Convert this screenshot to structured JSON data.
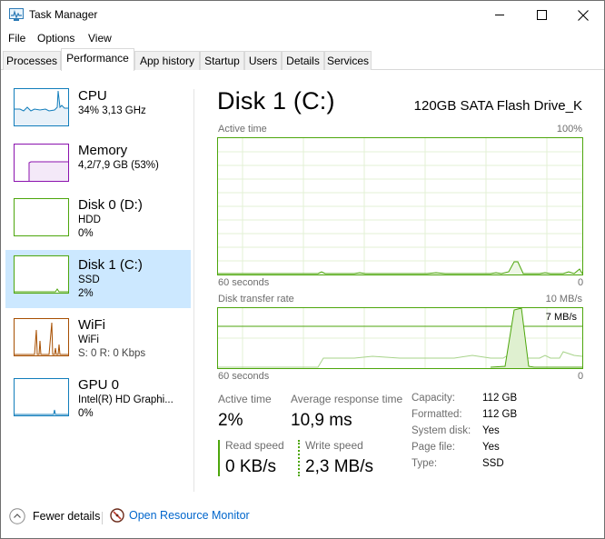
{
  "window": {
    "title": "Task Manager",
    "buttons": [
      "minimize",
      "maximize",
      "close"
    ]
  },
  "menu": {
    "items": [
      "File",
      "Options",
      "View"
    ]
  },
  "tabs": [
    {
      "label": "Processes",
      "active": false
    },
    {
      "label": "Performance",
      "active": true
    },
    {
      "label": "App history",
      "active": false
    },
    {
      "label": "Startup",
      "active": false
    },
    {
      "label": "Users",
      "active": false
    },
    {
      "label": "Details",
      "active": false
    },
    {
      "label": "Services",
      "active": false
    }
  ],
  "sidebar": {
    "items": [
      {
        "name": "CPU",
        "line1": "34% 3,13 GHz",
        "line2": "",
        "color": "#117dbb"
      },
      {
        "name": "Memory",
        "line1": "4,2/7,9 GB (53%)",
        "line2": "",
        "color": "#8b12ae"
      },
      {
        "name": "Disk 0 (D:)",
        "line1": "HDD",
        "line2": "0%",
        "color": "#4da60c"
      },
      {
        "name": "Disk 1 (C:)",
        "line1": "SSD",
        "line2": "2%",
        "color": "#4da60c",
        "selected": true
      },
      {
        "name": "WiFi",
        "line1": "WiFi",
        "line2": "S: 0 R: 0 Kbps",
        "color": "#a74f01"
      },
      {
        "name": "GPU 0",
        "line1": "Intel(R) HD Graphi...",
        "line2": "0%",
        "color": "#117dbb"
      }
    ]
  },
  "main": {
    "title": "Disk 1 (C:)",
    "model": "120GB SATA Flash Drive_K",
    "active_time_graph": {
      "label": "Active time",
      "max_label": "100%",
      "time_label": "60 seconds",
      "min_label": "0"
    },
    "transfer_graph": {
      "label": "Disk transfer rate",
      "max_label": "10 MB/s",
      "line_label": "7 MB/s",
      "time_label": "60 seconds",
      "min_label": "0"
    },
    "stats": {
      "active_time_label": "Active time",
      "active_time_value": "2%",
      "avg_response_label": "Average response time",
      "avg_response_value": "10,9 ms",
      "read_speed_label": "Read speed",
      "read_speed_value": "0 KB/s",
      "write_speed_label": "Write speed",
      "write_speed_value": "2,3 MB/s"
    },
    "properties": [
      {
        "label": "Capacity:",
        "value": "112 GB"
      },
      {
        "label": "Formatted:",
        "value": "112 GB"
      },
      {
        "label": "System disk:",
        "value": "Yes"
      },
      {
        "label": "Page file:",
        "value": "Yes"
      },
      {
        "label": "Type:",
        "value": "SSD"
      }
    ]
  },
  "footer": {
    "fewer_details": "Fewer details",
    "resource_monitor": "Open Resource Monitor"
  },
  "colors": {
    "disk": "#4da60c",
    "cpu": "#117dbb",
    "memory": "#8b12ae",
    "wifi": "#a74f01",
    "selection": "#cce8ff",
    "link": "#0066cc"
  }
}
